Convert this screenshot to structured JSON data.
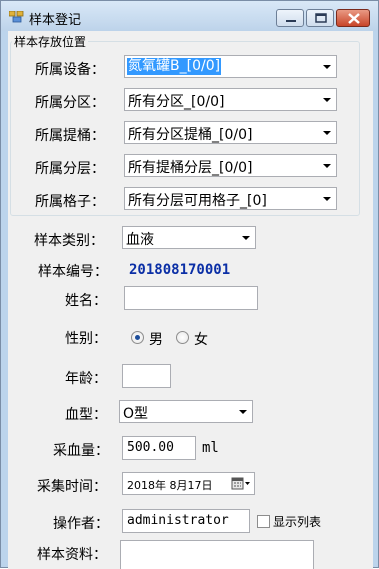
{
  "window": {
    "title": "样本登记",
    "min_icon": "minimize-icon",
    "max_icon": "maximize-icon",
    "close_icon": "close-icon"
  },
  "storage_group": {
    "legend": "样本存放位置",
    "fields": [
      {
        "label": "所属设备：",
        "value": "氮氧罐B_[0/0]",
        "selected": true
      },
      {
        "label": "所属分区：",
        "value": "所有分区_[0/0]"
      },
      {
        "label": "所属提桶：",
        "value": "所有分区提桶_[0/0]"
      },
      {
        "label": "所属分层：",
        "value": "所有提桶分层_[0/0]"
      },
      {
        "label": "所属格子：",
        "value": "所有分层可用格子_[0]"
      }
    ]
  },
  "form": {
    "sample_type": {
      "label": "样本类别：",
      "value": "血液"
    },
    "sample_no": {
      "label": "样本编号：",
      "value": "201808170001"
    },
    "name": {
      "label": "姓名：",
      "value": ""
    },
    "gender": {
      "label": "性别：",
      "options": [
        "男",
        "女"
      ],
      "selected": "男"
    },
    "age": {
      "label": "年龄：",
      "value": ""
    },
    "blood_type": {
      "label": "血型：",
      "value": "O型"
    },
    "blood_volume": {
      "label": "采血量：",
      "value": "500.00",
      "unit": "ml"
    },
    "collect_time": {
      "label": "采集时间：",
      "value": "2018年  8月17日",
      "icon": "calendar-icon"
    },
    "operator": {
      "label": "操作者：",
      "value": "administrator"
    },
    "show_list": {
      "label": "显示列表",
      "checked": false
    },
    "sample_info": {
      "label": "样本资料：",
      "value": ""
    }
  },
  "colors": {
    "titlebar": "#bdd3ea",
    "client_bg": "#f0f0f0",
    "selection": "#3399ff",
    "sample_no": "#0b2fa6",
    "close_button": "#c8452a"
  }
}
